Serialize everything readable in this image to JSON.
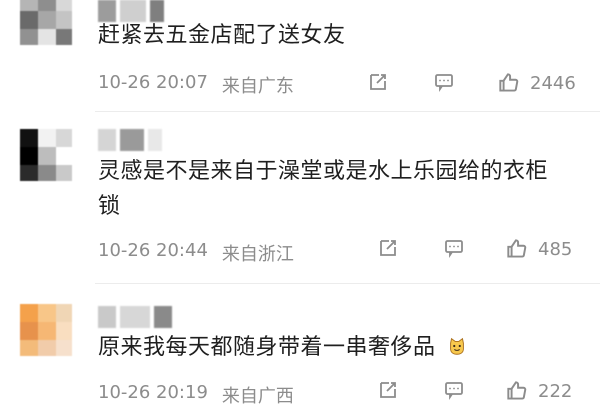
{
  "comments": [
    {
      "text": "赶紧去五金店配了送女友",
      "time": "10-26 20:07",
      "location": "来自广东",
      "likes": "2446",
      "avatar_colors": [
        "#b5b5b5",
        "#8e8e8e",
        "#d8d8d8",
        "#6a6a6a",
        "#a7a7a7",
        "#c4c4c4",
        "#919191",
        "#e4e4e4",
        "#787878"
      ],
      "name_colors": [
        "#9c9c9c",
        "#cfcfcf",
        "#7f7f7f"
      ]
    },
    {
      "text": "灵感是不是来自于澡堂或是水上乐园给的衣柜锁",
      "time": "10-26 20:44",
      "location": "来自浙江",
      "likes": "485",
      "avatar_colors": [
        "#111111",
        "#f2f2f2",
        "#d7d7d7",
        "#000000",
        "#bdbdbd",
        "#ffffff",
        "#2b2b2b",
        "#8a8a8a",
        "#c9c9c9"
      ],
      "name_colors": [
        "#d5d5d5",
        "#9a9a9a",
        "#e8e8e8"
      ]
    },
    {
      "text": "原来我每天都随身带着一串奢侈品",
      "time": "10-26 20:19",
      "location": "来自广西",
      "likes": "222",
      "avatar_colors": [
        "#f4a14b",
        "#f8c688",
        "#f0d6b5",
        "#e7924c",
        "#f6b774",
        "#f9dec0",
        "#f3bb7a",
        "#f1ccaa",
        "#f6e0cc"
      ],
      "name_colors": [
        "#c9c9c9",
        "#d7d7d7",
        "#8a8a8a"
      ]
    }
  ],
  "icons": {
    "share": "share-icon",
    "comment": "comment-icon",
    "like": "like-icon"
  },
  "colors": {
    "text": "#1f1f1f",
    "meta": "#8c8c8c",
    "divider": "#ececec"
  }
}
